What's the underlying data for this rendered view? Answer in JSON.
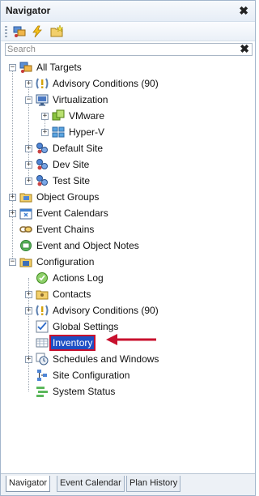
{
  "panel": {
    "title": "Navigator",
    "close_glyph": "✖"
  },
  "toolbar": {
    "buttons": [
      {
        "icon": "targets-icon"
      },
      {
        "icon": "lightning-icon"
      },
      {
        "icon": "folder-add-icon"
      }
    ]
  },
  "search": {
    "placeholder": "Search",
    "clear_glyph": "✖"
  },
  "tree": {
    "items": [
      {
        "label": "All Targets",
        "icon": "targets-icon",
        "expander": "−"
      },
      {
        "label": "Advisory Conditions (90)",
        "icon": "advisory-icon",
        "expander": "+"
      },
      {
        "label": "Virtualization",
        "icon": "monitor-icon",
        "expander": "−"
      },
      {
        "label": "VMware",
        "icon": "vmware-icon",
        "expander": "+"
      },
      {
        "label": "Hyper-V",
        "icon": "hyperv-icon",
        "expander": "+"
      },
      {
        "label": "Default Site",
        "icon": "site-icon",
        "expander": "+"
      },
      {
        "label": "Dev Site",
        "icon": "site-icon",
        "expander": "+"
      },
      {
        "label": "Test Site",
        "icon": "site-icon",
        "expander": "+"
      },
      {
        "label": "Object Groups",
        "icon": "folder-icon",
        "expander": "+"
      },
      {
        "label": "Event Calendars",
        "icon": "calendar-icon",
        "expander": "+"
      },
      {
        "label": "Event Chains",
        "icon": "chain-icon",
        "expander": ""
      },
      {
        "label": "Event and Object Notes",
        "icon": "notes-icon",
        "expander": ""
      },
      {
        "label": "Configuration",
        "icon": "config-folder-icon",
        "expander": "−"
      },
      {
        "label": "Actions Log",
        "icon": "actions-log-icon",
        "expander": ""
      },
      {
        "label": "Contacts",
        "icon": "contacts-folder-icon",
        "expander": "+"
      },
      {
        "label": "Advisory Conditions (90)",
        "icon": "advisory-icon",
        "expander": "+"
      },
      {
        "label": "Global Settings",
        "icon": "checklist-icon",
        "expander": ""
      },
      {
        "label": "Inventory",
        "icon": "grid-icon",
        "expander": "",
        "selected": true
      },
      {
        "label": "Schedules and Windows",
        "icon": "clock-icon",
        "expander": "+"
      },
      {
        "label": "Site Configuration",
        "icon": "site-config-icon",
        "expander": ""
      },
      {
        "label": "System Status",
        "icon": "status-icon",
        "expander": ""
      }
    ]
  },
  "tabs": [
    {
      "label": "Navigator",
      "active": true
    },
    {
      "label": "Event Calendar",
      "active": false
    },
    {
      "label": "Plan History",
      "active": false
    }
  ],
  "colors": {
    "selection_bg": "#1e4fc4",
    "callout_red": "#c8102e",
    "panel_border": "#a3b6cc"
  }
}
